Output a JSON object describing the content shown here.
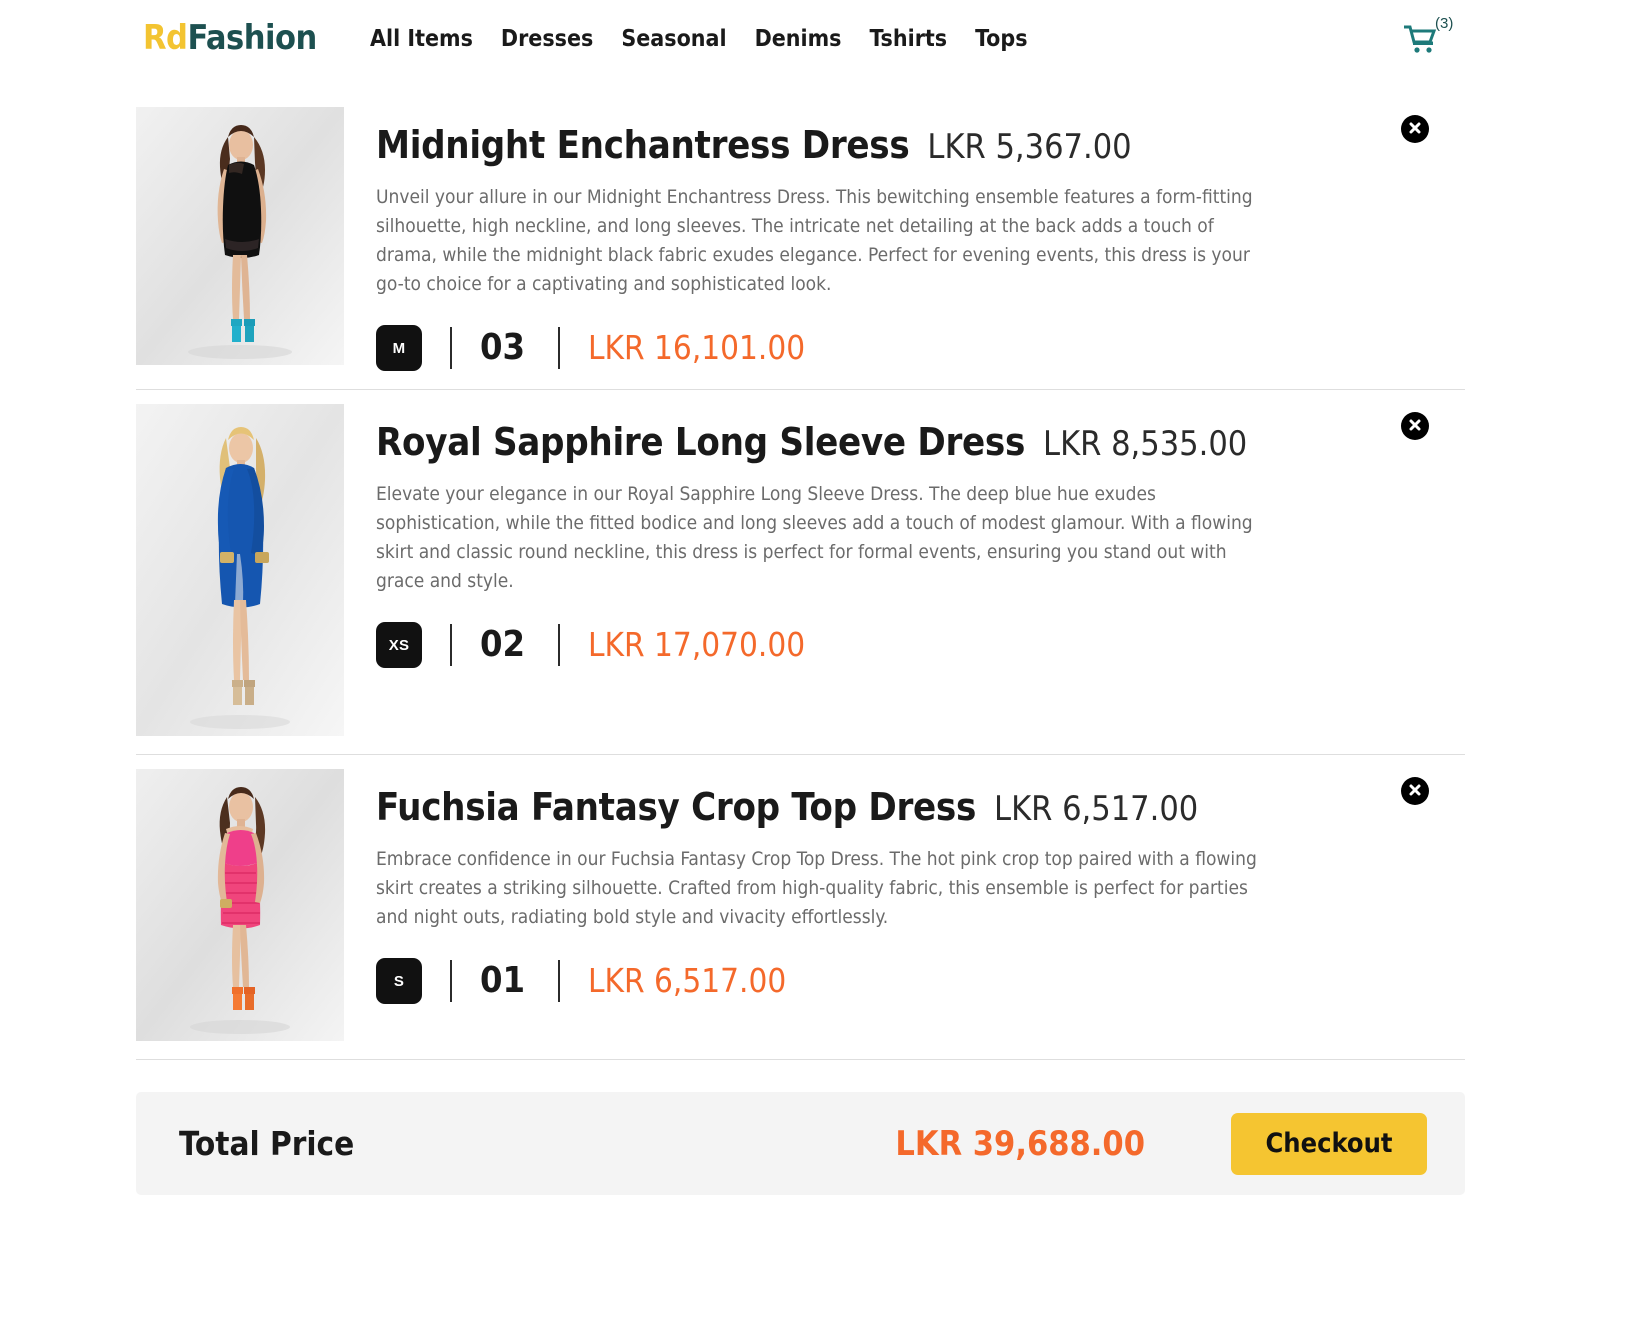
{
  "header": {
    "logo_primary": "Rd",
    "logo_secondary": "Fashion",
    "logo_color_primary": "#F3C431",
    "logo_color_secondary": "#1D5050",
    "nav": [
      {
        "label": "All Items"
      },
      {
        "label": "Dresses"
      },
      {
        "label": "Seasonal"
      },
      {
        "label": "Denims"
      },
      {
        "label": "Tshirts"
      },
      {
        "label": "Tops"
      }
    ],
    "cart": {
      "icon": "shopping-cart-icon",
      "badge": "(3)",
      "color": "#1D7A7A"
    }
  },
  "accent": {
    "orange": "#F4692B",
    "yellow": "#F5C531",
    "teal": "#1D5050"
  },
  "items": [
    {
      "title": "Midnight Enchantress Dress",
      "unit_price": "LKR 5,367.00",
      "description": "Unveil your allure in our Midnight Enchantress Dress. This bewitching ensemble features a form-fitting silhouette, high neckline, and long sleeves. The intricate net detailing at the back adds a touch of drama, while the midnight black fabric exudes elegance. Perfect for evening events, this dress is your go-to choice for a captivating and sophisticated look.",
      "size": "M",
      "quantity": "03",
      "subtotal": "LKR 16,101.00",
      "remove_icon": "close-circle-icon",
      "image_alt": "model-in-black-dress"
    },
    {
      "title": "Royal Sapphire Long Sleeve Dress",
      "unit_price": "LKR 8,535.00",
      "description": "Elevate your elegance in our Royal Sapphire Long Sleeve Dress. The deep blue hue exudes sophistication, while the fitted bodice and long sleeves add a touch of modest glamour. With a flowing skirt and classic round neckline, this dress is perfect for formal events, ensuring you stand out with grace and style.",
      "size": "XS",
      "quantity": "02",
      "subtotal": "LKR 17,070.00",
      "remove_icon": "close-circle-icon",
      "image_alt": "model-in-blue-long-sleeve-dress"
    },
    {
      "title": "Fuchsia Fantasy Crop Top Dress",
      "unit_price": "LKR 6,517.00",
      "description": "Embrace confidence in our Fuchsia Fantasy Crop Top Dress. The hot pink crop top paired with a flowing skirt creates a striking silhouette. Crafted from high-quality fabric, this ensemble is perfect for parties and night outs, radiating bold style and vivacity effortlessly.",
      "size": "S",
      "quantity": "01",
      "subtotal": "LKR 6,517.00",
      "remove_icon": "close-circle-icon",
      "image_alt": "model-in-pink-crop-top-dress"
    }
  ],
  "footer": {
    "total_label": "Total Price",
    "total_amount": "LKR 39,688.00",
    "checkout_label": "Checkout"
  }
}
